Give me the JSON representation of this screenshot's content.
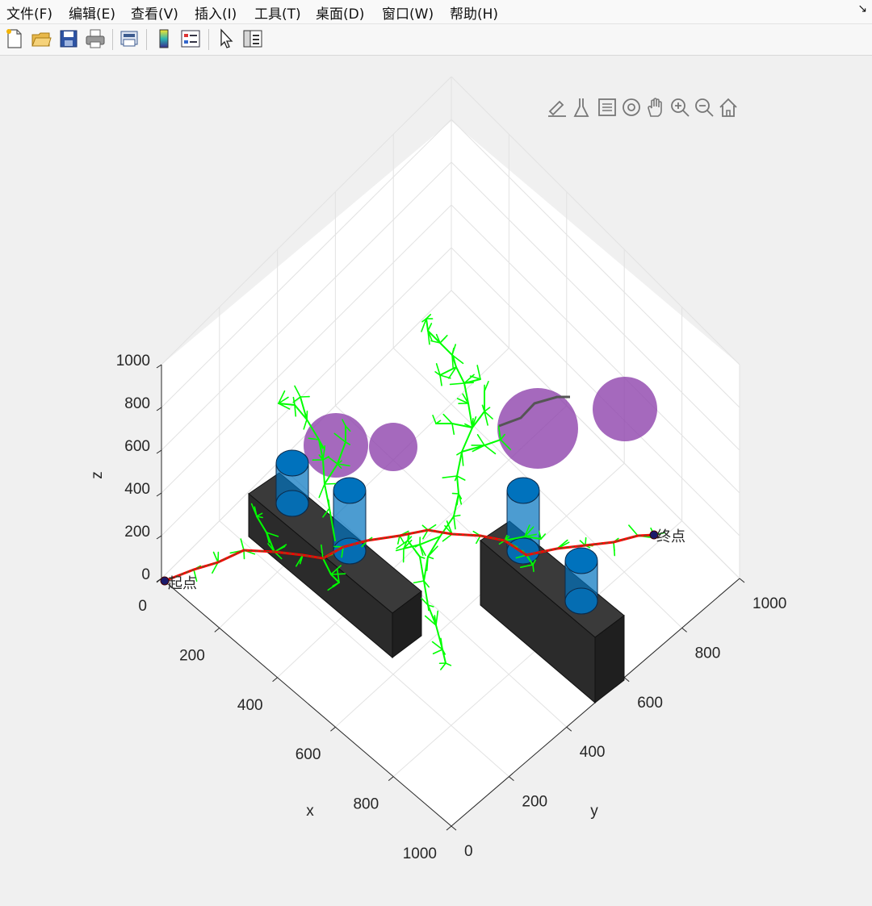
{
  "menu": [
    "文件(F)",
    "编辑(E)",
    "查看(V)",
    "插入(I)",
    "工具(T)",
    "桌面(D)",
    "窗口(W)",
    "帮助(H)"
  ],
  "toolbar_icons": [
    "new-file-icon",
    "open-folder-icon",
    "save-icon",
    "print-icon",
    "print-preview-icon",
    "colorbar-icon",
    "legend-icon",
    "pointer-arrow-icon",
    "property-inspector-icon"
  ],
  "axes_toolbar_icons": [
    "brush-edit-icon",
    "data-cursor-icon",
    "legend-toggle-icon",
    "rotate-3d-icon",
    "pan-hand-icon",
    "zoom-in-icon",
    "zoom-out-icon",
    "home-icon"
  ],
  "plot": {
    "x_label": "x",
    "y_label": "y",
    "z_label": "z",
    "x_ticks": [
      "0",
      "200",
      "400",
      "600",
      "800",
      "1000"
    ],
    "y_ticks": [
      "0",
      "200",
      "400",
      "600",
      "800",
      "1000"
    ],
    "z_ticks": [
      "0",
      "200",
      "400",
      "600",
      "800",
      "1000"
    ],
    "start_label": "起点",
    "end_label": "终点",
    "tree_color": "#00ff00",
    "path_color": "#ff0000",
    "sphere_color": "#9b59b6",
    "cylinder_color": "#0072bd",
    "block_color": "#262626"
  }
}
